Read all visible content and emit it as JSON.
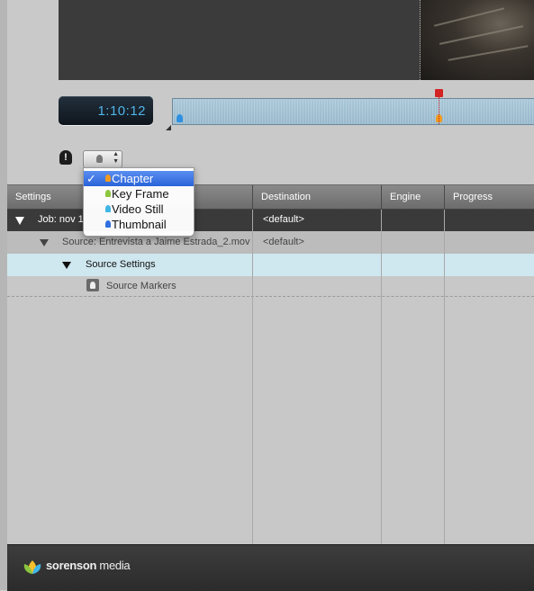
{
  "preview": {
    "timecode": "1:10:12"
  },
  "marker_menu": {
    "items": [
      {
        "label": "Chapter",
        "selected": true,
        "color": "#f29a1f"
      },
      {
        "label": "Key Frame",
        "selected": false,
        "color": "#8cc63f"
      },
      {
        "label": "Video Still",
        "selected": false,
        "color": "#3fb6e6"
      },
      {
        "label": "Thumbnail",
        "selected": false,
        "color": "#2f6fe0"
      }
    ],
    "checkmark": "✓"
  },
  "table": {
    "columns": [
      "Settings",
      "Destination",
      "Engine",
      "Progress"
    ],
    "rows": [
      {
        "label": "Job: nov 1",
        "destination": "<default>"
      },
      {
        "label": "Source: Entrevista a Jaime Estrada_2.mov",
        "destination": "<default>"
      },
      {
        "label": "Source Settings",
        "destination": ""
      },
      {
        "label": "Source Markers",
        "destination": ""
      }
    ]
  },
  "footer": {
    "brand_bold": "sorenson",
    "brand_light": " media"
  },
  "icons": {
    "marker": "marker-pin-icon",
    "logo": "sorenson-lotus-icon"
  }
}
